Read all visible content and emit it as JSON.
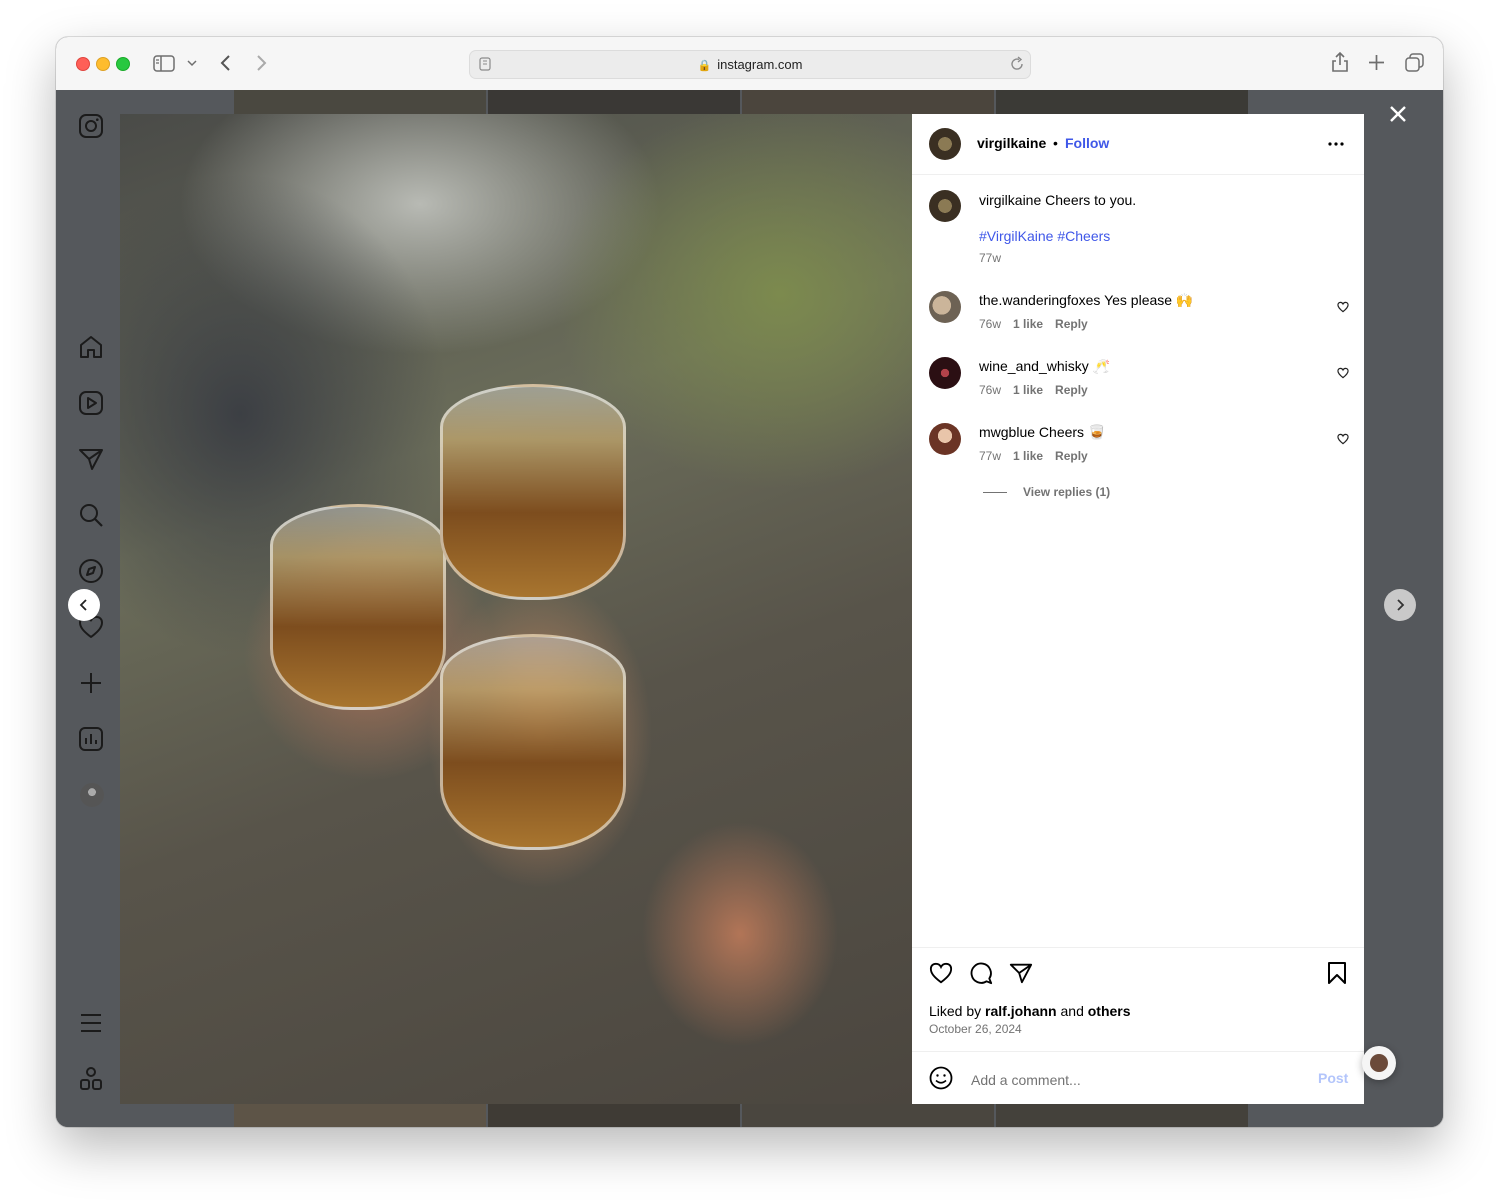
{
  "browser": {
    "url": "instagram.com"
  },
  "sidebar": {
    "items": [
      {
        "icon": "instagram-icon"
      },
      {
        "icon": "home-icon"
      },
      {
        "icon": "reels-icon"
      },
      {
        "icon": "messages-icon"
      },
      {
        "icon": "search-icon"
      },
      {
        "icon": "explore-icon"
      },
      {
        "icon": "heart-icon"
      },
      {
        "icon": "create-icon"
      },
      {
        "icon": "insights-icon"
      },
      {
        "icon": "profile-avatar"
      },
      {
        "icon": "menu-icon"
      },
      {
        "icon": "apps-icon"
      }
    ]
  },
  "post": {
    "author": "virgilkaine",
    "separator": "•",
    "follow_label": "Follow",
    "caption": {
      "username": "virgilkaine",
      "text": "Cheers to you.",
      "hashtags": "#VirgilKaine #Cheers",
      "time": "77w"
    },
    "comments": [
      {
        "username": "the.wanderingfoxes",
        "text": "Yes please 🙌",
        "time": "76w",
        "likes": "1 like",
        "reply": "Reply"
      },
      {
        "username": "wine_and_whisky",
        "text": "🥂",
        "time": "76w",
        "likes": "1 like",
        "reply": "Reply"
      },
      {
        "username": "mwgblue",
        "text": "Cheers 🥃",
        "time": "77w",
        "likes": "1 like",
        "reply": "Reply"
      }
    ],
    "view_replies": "View replies (1)",
    "liked_by_prefix": "Liked by",
    "liked_by_user": "ralf.johann",
    "liked_by_and": "and",
    "liked_by_others": "others",
    "date": "October 26, 2024",
    "comment_placeholder": "Add a comment...",
    "post_label": "Post"
  },
  "colors": {
    "link": "#3f57e8",
    "post_disabled": "#b3c5fb",
    "overlay": "#55585c"
  }
}
